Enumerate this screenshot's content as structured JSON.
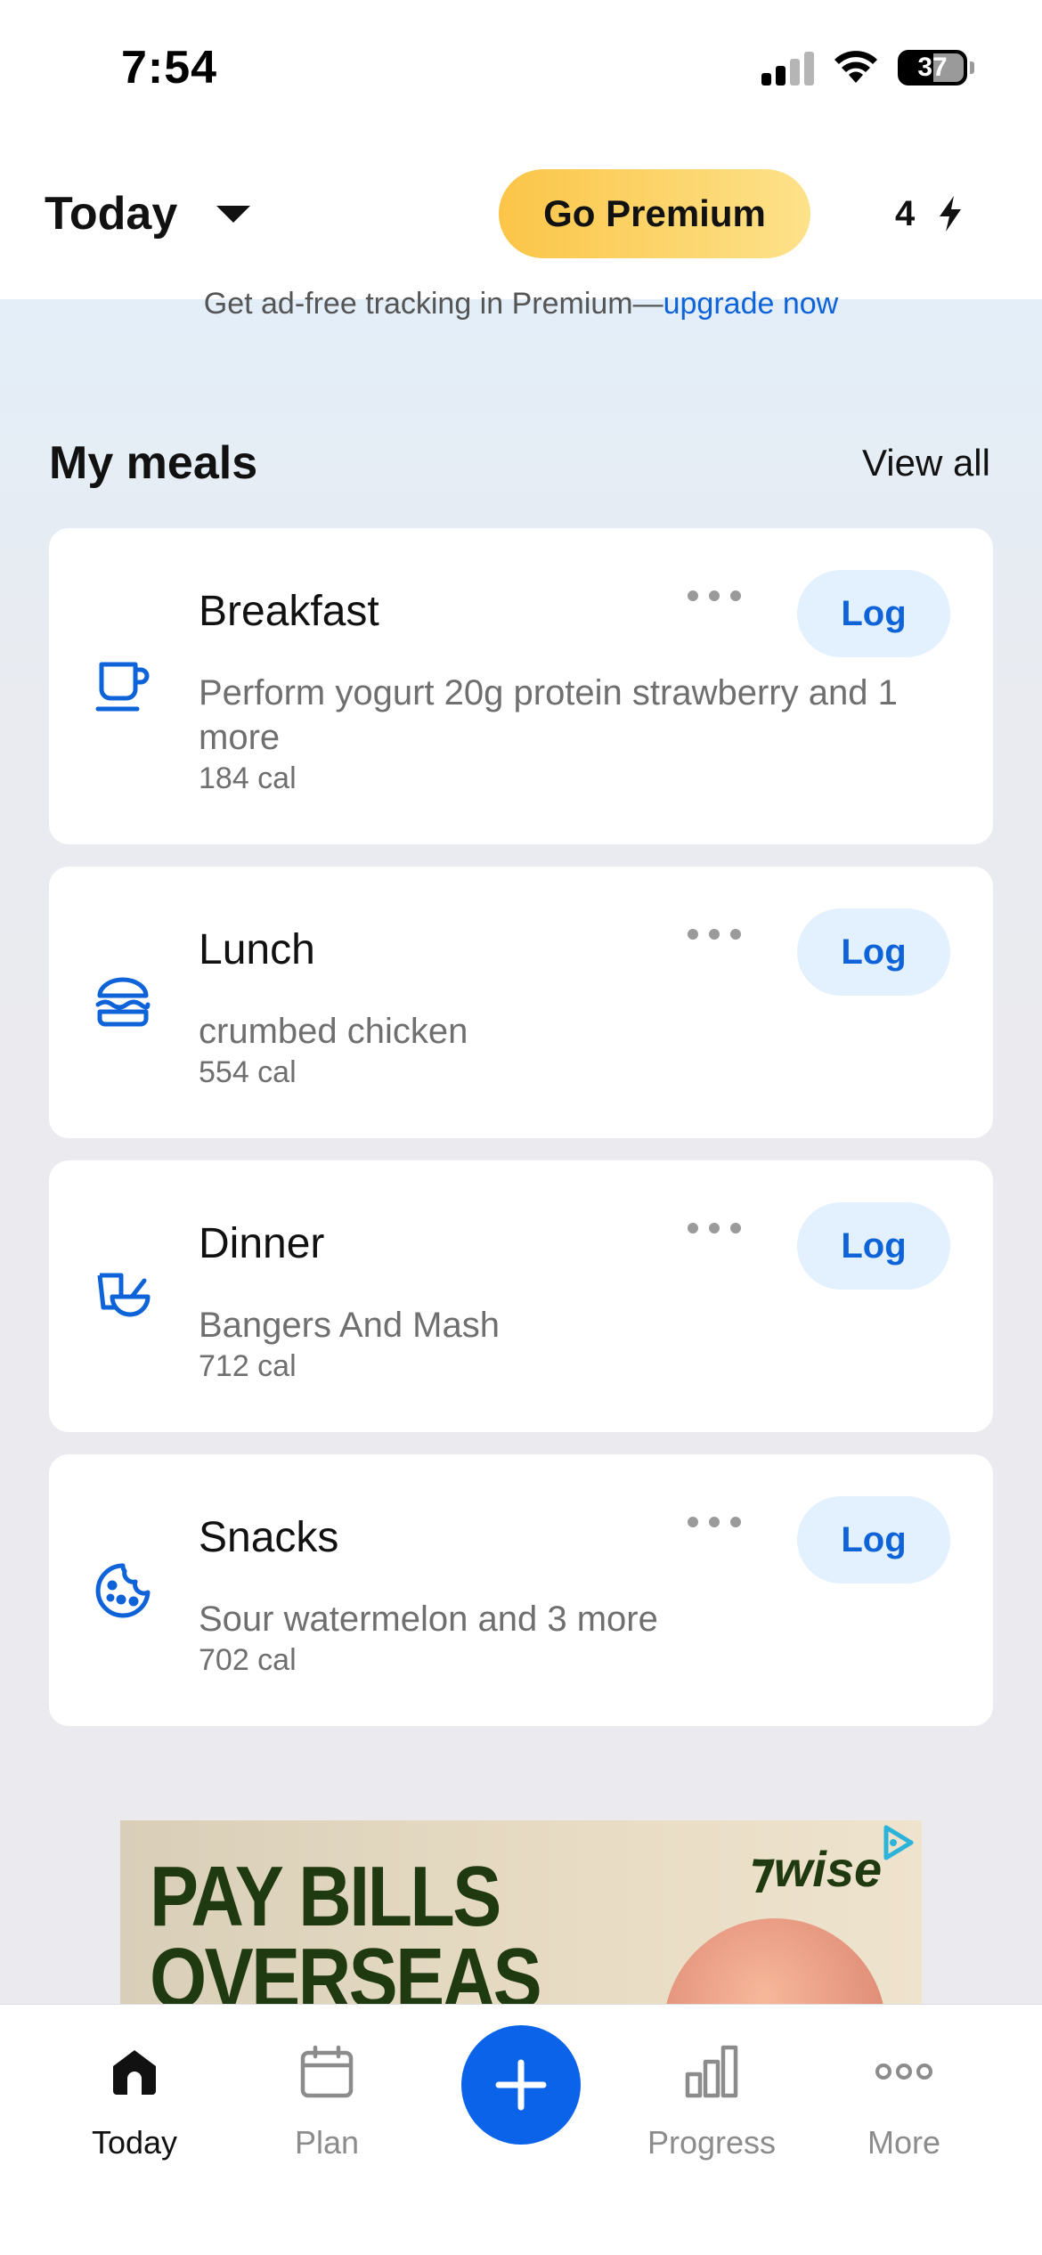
{
  "status_bar": {
    "time": "7:54",
    "battery": "37"
  },
  "header": {
    "day_label": "Today",
    "premium_label": "Go Premium",
    "streak_count": "4"
  },
  "promo": {
    "text": "Get ad-free tracking in Premium—",
    "link": "upgrade now"
  },
  "meals_section": {
    "title": "My meals",
    "view_all": "View all"
  },
  "meals": [
    {
      "name": "Breakfast",
      "icon": "coffee-cup-icon",
      "description": "Perform yogurt 20g protein strawberry and 1 more",
      "calories": "184 cal",
      "log_label": "Log"
    },
    {
      "name": "Lunch",
      "icon": "burger-icon",
      "description": "crumbed chicken",
      "calories": "554 cal",
      "log_label": "Log"
    },
    {
      "name": "Dinner",
      "icon": "bowl-icon",
      "description": "Bangers And Mash",
      "calories": "712 cal",
      "log_label": "Log"
    },
    {
      "name": "Snacks",
      "icon": "cookie-icon",
      "description": "Sour watermelon and 3 more",
      "calories": "702 cal",
      "log_label": "Log"
    }
  ],
  "ad": {
    "headline_line1": "PAY BILLS",
    "headline_line2": "OVERSEAS",
    "brand": "wise"
  },
  "tabbar": {
    "tabs": [
      {
        "label": "Today",
        "icon": "home-icon",
        "active": true
      },
      {
        "label": "Plan",
        "icon": "calendar-icon",
        "active": false
      },
      {
        "label": "Progress",
        "icon": "bar-chart-icon",
        "active": false
      },
      {
        "label": "More",
        "icon": "more-dots-icon",
        "active": false
      }
    ],
    "add_icon": "plus-icon"
  },
  "colors": {
    "accent": "#0a63e8",
    "premium": "#fbc548",
    "log_bg": "#e2f1fd"
  }
}
